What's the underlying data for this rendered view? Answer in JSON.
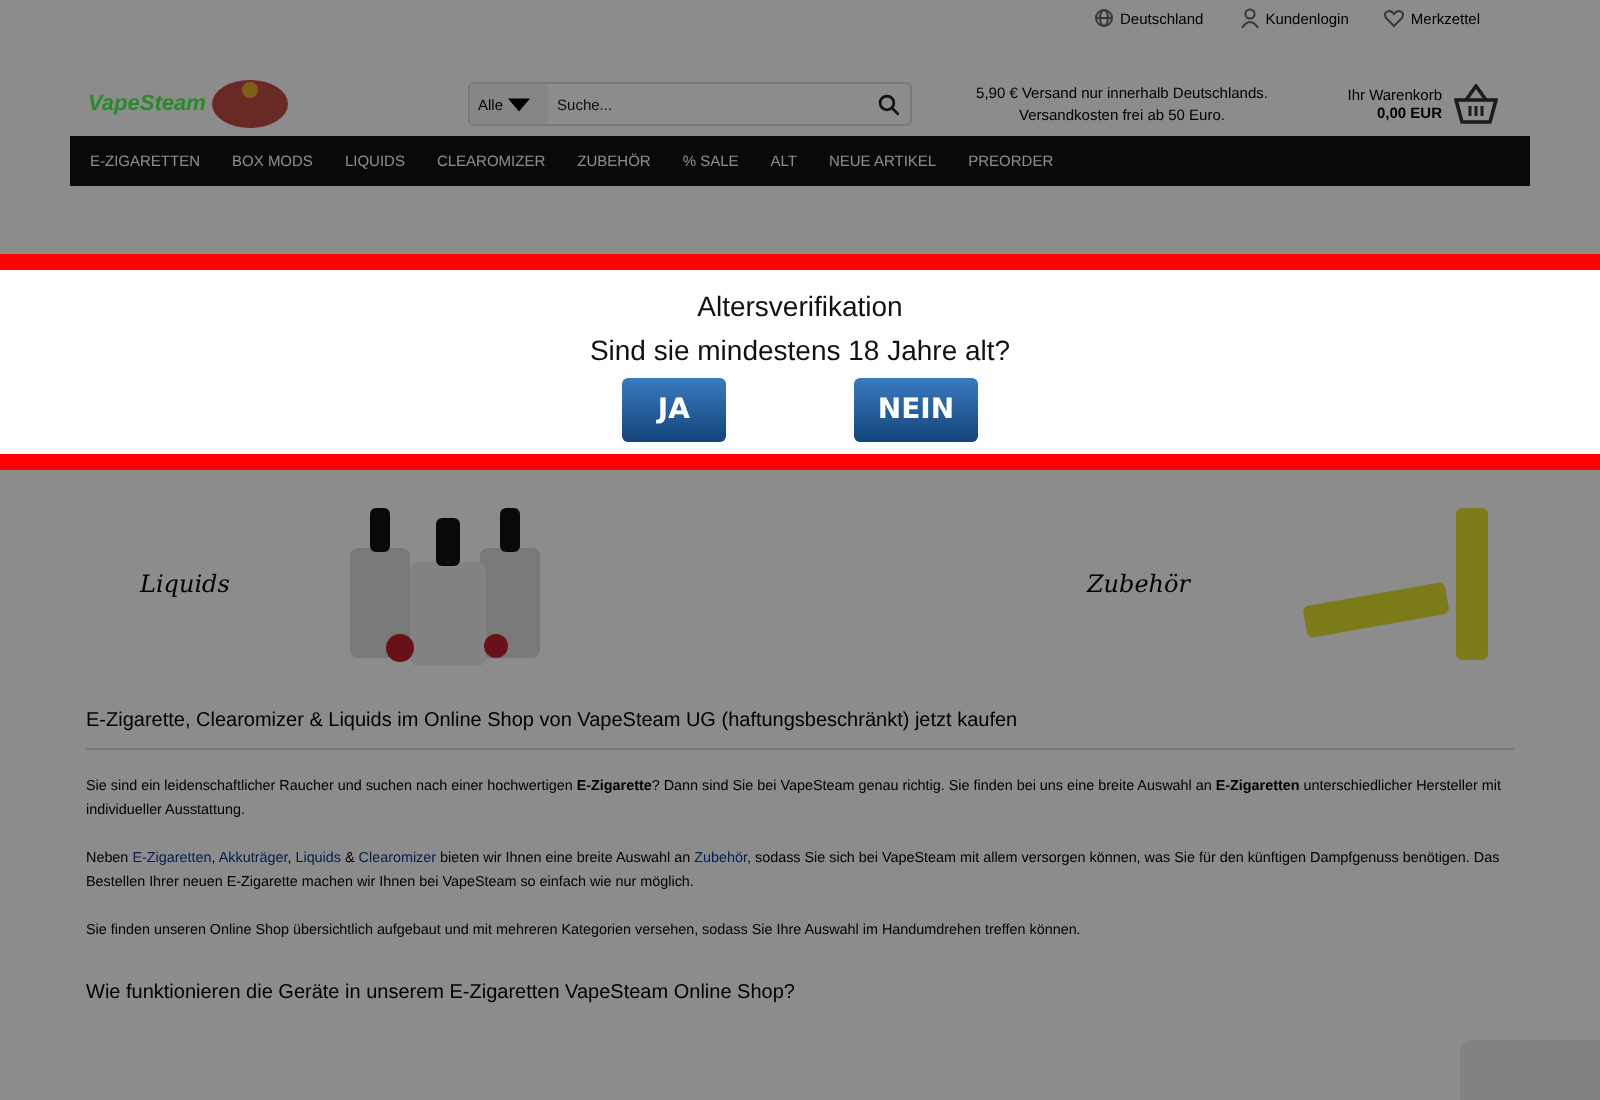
{
  "top_bar": {
    "links": [
      "Deutschland",
      "Kundenlogin",
      "Merkzettel"
    ]
  },
  "header": {
    "logo": "VapeSteam",
    "search": {
      "category": "Alle",
      "placeholder": "Suche..."
    },
    "shipping_note": [
      "5,90 € Versand nur innerhalb Deutschlands.",
      "Versandkosten frei ab 50 Euro."
    ],
    "cart": {
      "label": "Ihr Warenkorb",
      "amount": "0,00 EUR"
    }
  },
  "nav": [
    "E-ZIGARETTEN",
    "BOX MODS",
    "LIQUIDS",
    "CLEAROMIZER",
    "ZUBEHÖR",
    "% SALE",
    "ALT",
    "NEUE ARTIKEL",
    "PREORDER"
  ],
  "banners": [
    {
      "label": "Liquids",
      "kind": "bottles"
    },
    {
      "label": "Zubehör",
      "kind": "batteries"
    }
  ],
  "content": {
    "heading": "E-Zigarette, Clearomizer & Liquids im Online Shop von VapeSteam UG (haftungsbeschränkt) jetzt kaufen",
    "paragraphs": [
      [
        {
          "kind": "text",
          "text": "Sie sind ein leidenschaftlicher Raucher und suchen nach einer hochwertigen "
        },
        {
          "kind": "bold",
          "text": "E-Zigarette"
        },
        {
          "kind": "text",
          "text": "? Dann sind Sie bei VapeSteam genau richtig. Sie finden bei uns eine breite Auswahl an "
        },
        {
          "kind": "bold",
          "text": "E-Zigaretten"
        },
        {
          "kind": "text",
          "text": " unterschiedlicher Hersteller mit individueller Ausstattung."
        }
      ],
      [
        {
          "kind": "text",
          "text": "Neben "
        },
        {
          "kind": "link",
          "text": "E-Zigaretten"
        },
        {
          "kind": "text",
          "text": ", "
        },
        {
          "kind": "link",
          "text": "Akkuträger"
        },
        {
          "kind": "text",
          "text": ", "
        },
        {
          "kind": "link",
          "text": "Liquids"
        },
        {
          "kind": "text",
          "text": " & "
        },
        {
          "kind": "link",
          "text": "Clearomizer"
        },
        {
          "kind": "text",
          "text": " bieten wir Ihnen eine breite Auswahl an "
        },
        {
          "kind": "link",
          "text": "Zubehör"
        },
        {
          "kind": "text",
          "text": ", sodass Sie sich bei VapeSteam mit allem versorgen können, was Sie für den künftigen Dampfgenuss benötigen. Das Bestellen Ihrer neuen E-Zigarette machen wir Ihnen bei VapeSteam so einfach wie nur möglich."
        }
      ],
      [
        {
          "kind": "text",
          "text": "Sie finden unseren Online Shop übersichtlich aufgebaut und mit mehreren Kategorien versehen, sodass Sie Ihre Auswahl im Handumdrehen treffen können."
        }
      ]
    ],
    "subheading": "Wie funktionieren die Geräte in unserem E-Zigaretten VapeSteam Online Shop?"
  },
  "modal": {
    "title": "Altersverifikation",
    "question": "Sind sie mindestens 18 Jahre alt?",
    "buttons": [
      "JA",
      "NEIN"
    ]
  }
}
